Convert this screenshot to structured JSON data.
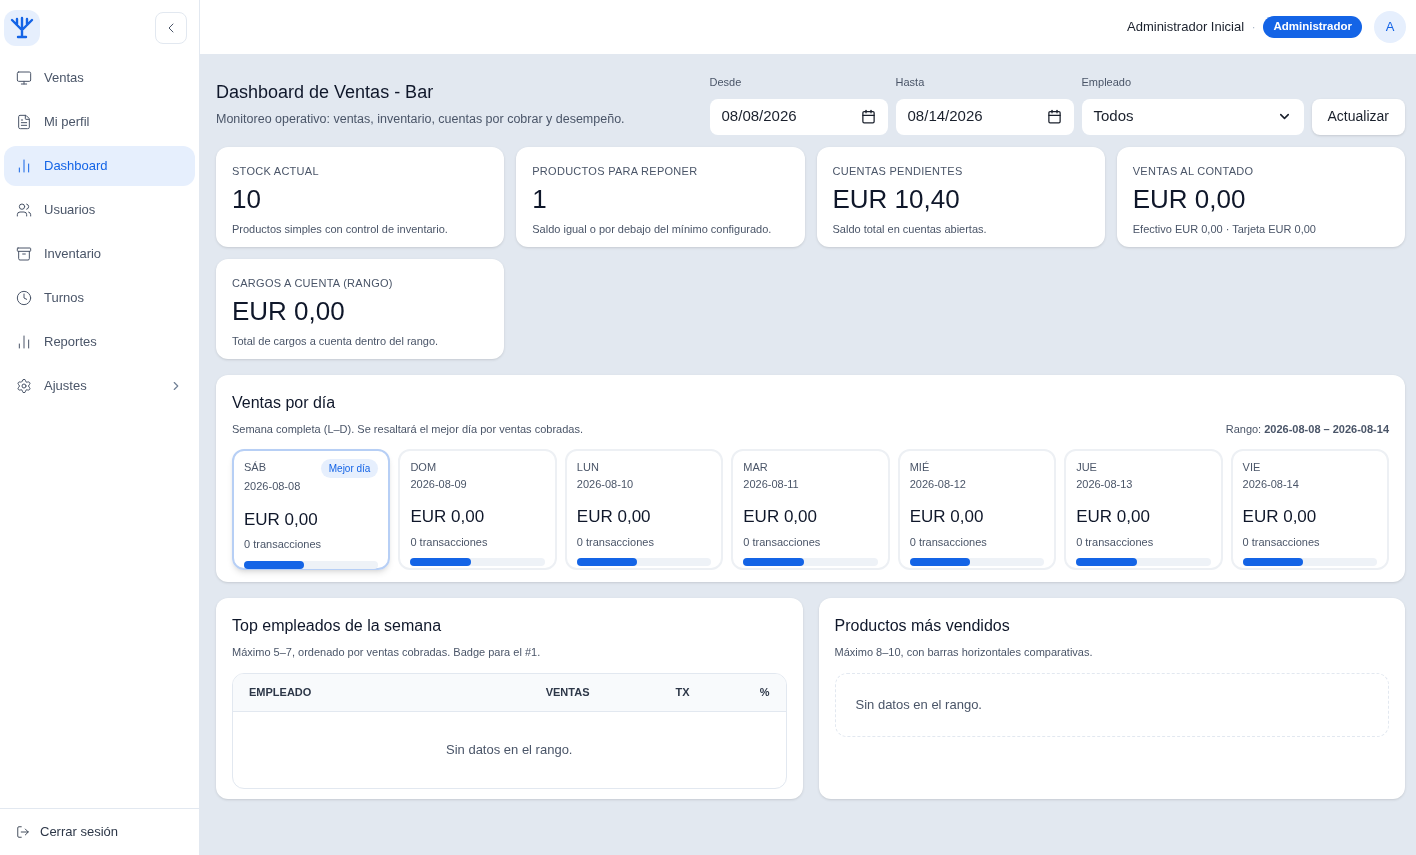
{
  "sidebar": {
    "items": [
      {
        "label": "Ventas",
        "selected": false
      },
      {
        "label": "Mi perfil",
        "selected": false
      },
      {
        "label": "Dashboard",
        "selected": true
      },
      {
        "label": "Usuarios",
        "selected": false
      },
      {
        "label": "Inventario",
        "selected": false
      },
      {
        "label": "Turnos",
        "selected": false
      },
      {
        "label": "Reportes",
        "selected": false
      },
      {
        "label": "Ajustes",
        "selected": false,
        "has_children": true
      }
    ],
    "logout": "Cerrar sesión"
  },
  "header": {
    "user": "Administrador Inicial",
    "separator": "·",
    "role": "Administrador",
    "avatar": "A"
  },
  "page": {
    "title": "Dashboard de Ventas - Bar",
    "subtitle": "Monitoreo operativo: ventas, inventario, cuentas por cobrar y desempeño."
  },
  "filters": {
    "from": {
      "label": "Desde",
      "value": "08/08/2026"
    },
    "to": {
      "label": "Hasta",
      "value": "08/14/2026"
    },
    "employee": {
      "label": "Empleado",
      "value": "Todos"
    },
    "button": "Actualizar"
  },
  "kpis": [
    {
      "title": "STOCK ACTUAL",
      "value": "10",
      "note": "Productos simples con control de inventario."
    },
    {
      "title": "PRODUCTOS PARA REPONER",
      "value": "1",
      "note": "Saldo igual o por debajo del mínimo configurado."
    },
    {
      "title": "CUENTAS PENDIENTES",
      "value": "EUR 10,40",
      "note": "Saldo total en cuentas abiertas."
    },
    {
      "title": "VENTAS AL CONTADO",
      "value": "EUR 0,00",
      "note": "Efectivo EUR 0,00 · Tarjeta EUR 0,00"
    },
    {
      "title": "CARGOS A CUENTA (RANGO)",
      "value": "EUR 0,00",
      "note": "Total de cargos a cuenta dentro del rango."
    }
  ],
  "daily": {
    "title": "Ventas por día",
    "subtitle": "Semana completa (L–D). Se resaltará el mejor día por ventas cobradas.",
    "range": "Rango: **2026-08-08 – 2026-08-14**",
    "best_badge": "Mejor día",
    "days": [
      {
        "day": "SÁB",
        "date": "2026-08-08",
        "amount": "EUR 0,00",
        "tx": "0 transacciones",
        "level": 0.45,
        "selected": true
      },
      {
        "day": "DOM",
        "date": "2026-08-09",
        "amount": "EUR 0,00",
        "tx": "0 transacciones",
        "level": 0.45,
        "selected": false
      },
      {
        "day": "LUN",
        "date": "2026-08-10",
        "amount": "EUR 0,00",
        "tx": "0 transacciones",
        "level": 0.45,
        "selected": false
      },
      {
        "day": "MAR",
        "date": "2026-08-11",
        "amount": "EUR 0,00",
        "tx": "0 transacciones",
        "level": 0.45,
        "selected": false
      },
      {
        "day": "MIÉ",
        "date": "2026-08-12",
        "amount": "EUR 0,00",
        "tx": "0 transacciones",
        "level": 0.45,
        "selected": false
      },
      {
        "day": "JUE",
        "date": "2026-08-13",
        "amount": "EUR 0,00",
        "tx": "0 transacciones",
        "level": 0.45,
        "selected": false
      },
      {
        "day": "VIE",
        "date": "2026-08-14",
        "amount": "EUR 0,00",
        "tx": "0 transacciones",
        "level": 0.45,
        "selected": false
      }
    ]
  },
  "top_employees": {
    "title": "Top empleados de la semana",
    "subtitle": "Máximo 5–7, ordenado por ventas cobradas. Badge para el #1.",
    "columns": [
      "EMPLEADO",
      "VENTAS",
      "TX",
      "%"
    ],
    "empty": "Sin datos en el rango."
  },
  "top_products": {
    "title": "Productos más vendidos",
    "subtitle": "Máximo 8–10, con barras horizontales comparativas.",
    "empty": "Sin datos en el rango."
  }
}
